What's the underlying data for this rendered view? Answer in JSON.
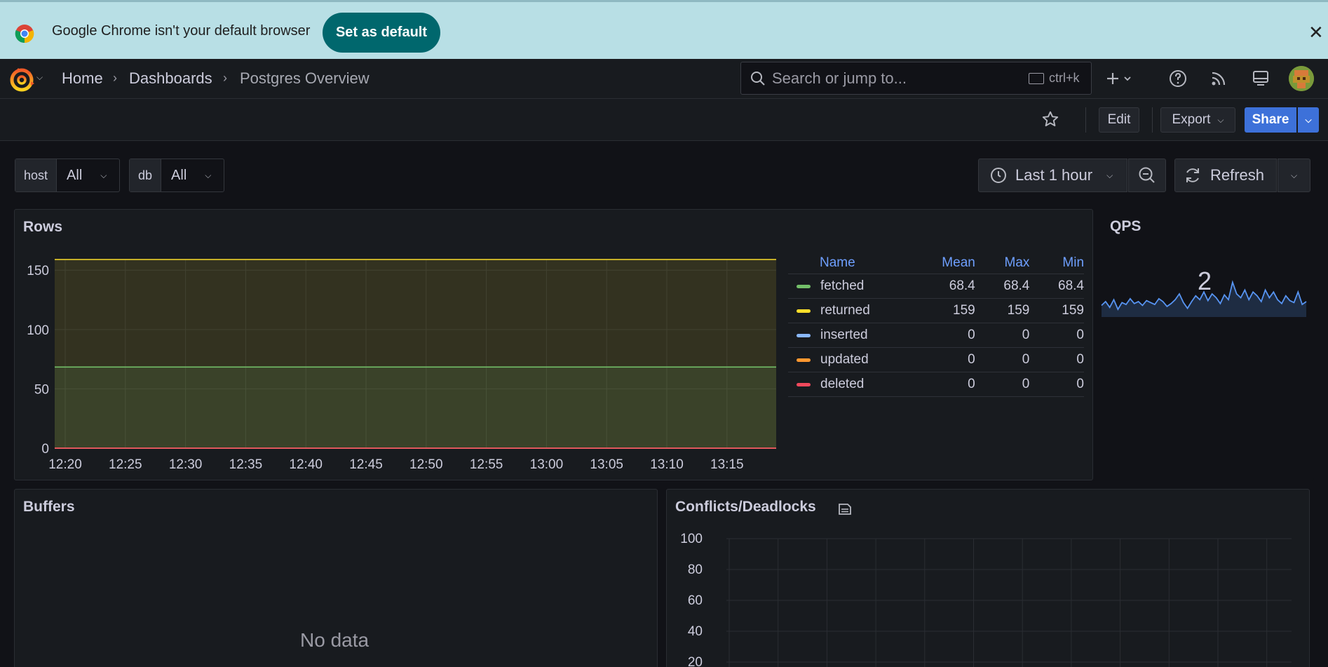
{
  "infobar": {
    "message": "Google Chrome isn't your default browser",
    "button": "Set as default",
    "close": "✕"
  },
  "nav": {
    "breadcrumbs": [
      "Home",
      "Dashboards",
      "Postgres Overview"
    ],
    "search_placeholder": "Search or jump to...",
    "search_shortcut": "ctrl+k"
  },
  "toolbar": {
    "edit": "Edit",
    "export": "Export",
    "share": "Share"
  },
  "variables": [
    {
      "label": "host",
      "value": "All"
    },
    {
      "label": "db",
      "value": "All"
    }
  ],
  "time": {
    "range": "Last 1 hour",
    "refresh": "Refresh"
  },
  "panels": {
    "rows": {
      "title": "Rows"
    },
    "qps": {
      "title": "QPS",
      "value": "2"
    },
    "buffers": {
      "title": "Buffers",
      "empty": "No data"
    },
    "conflicts": {
      "title": "Conflicts/Deadlocks"
    }
  },
  "legend": {
    "headers": [
      "Name",
      "Mean",
      "Max",
      "Min"
    ],
    "rows": [
      {
        "name": "fetched",
        "mean": "68.4",
        "max": "68.4",
        "min": "68.4",
        "color": "#73bf69"
      },
      {
        "name": "returned",
        "mean": "159",
        "max": "159",
        "min": "159",
        "color": "#fade2a"
      },
      {
        "name": "inserted",
        "mean": "0",
        "max": "0",
        "min": "0",
        "color": "#8ab8ff"
      },
      {
        "name": "updated",
        "mean": "0",
        "max": "0",
        "min": "0",
        "color": "#ff9830"
      },
      {
        "name": "deleted",
        "mean": "0",
        "max": "0",
        "min": "0",
        "color": "#f2495c"
      }
    ]
  },
  "chart_data": [
    {
      "type": "area",
      "title": "Rows",
      "x": [
        "12:20",
        "12:25",
        "12:30",
        "12:35",
        "12:40",
        "12:45",
        "12:50",
        "12:55",
        "13:00",
        "13:05",
        "13:10",
        "13:15"
      ],
      "ylim": [
        0,
        159
      ],
      "yticks": [
        0,
        50,
        100,
        150
      ],
      "series": [
        {
          "name": "fetched",
          "value": 68.4,
          "color": "#73bf69"
        },
        {
          "name": "returned",
          "value": 159,
          "color": "#fade2a"
        },
        {
          "name": "inserted",
          "value": 0,
          "color": "#8ab8ff"
        },
        {
          "name": "updated",
          "value": 0,
          "color": "#ff9830"
        },
        {
          "name": "deleted",
          "value": 0,
          "color": "#f2495c"
        }
      ],
      "grid": true
    },
    {
      "type": "line",
      "title": "QPS",
      "values": [
        1.2,
        1.6,
        1.0,
        1.8,
        0.8,
        1.5,
        1.3,
        1.9,
        1.4,
        1.6,
        1.2,
        1.7,
        1.5,
        1.3,
        1.9,
        1.6,
        1.1,
        1.4,
        1.8,
        2.4,
        1.5,
        0.9,
        1.6,
        2.2,
        1.8,
        2.6,
        1.7,
        2.4,
        2.0,
        1.4,
        2.3,
        1.8,
        3.6,
        2.4,
        2.0,
        2.8,
        1.8,
        2.6,
        2.2,
        1.6,
        2.8,
        2.0,
        2.6,
        1.8,
        1.4,
        2.2,
        1.7,
        1.5,
        2.6,
        1.3,
        1.6
      ],
      "color": "#5794f2"
    },
    {
      "type": "line",
      "title": "Conflicts/Deadlocks",
      "yticks": [
        20,
        40,
        60,
        80,
        100
      ],
      "ylim": [
        0,
        100
      ],
      "grid": true
    }
  ]
}
